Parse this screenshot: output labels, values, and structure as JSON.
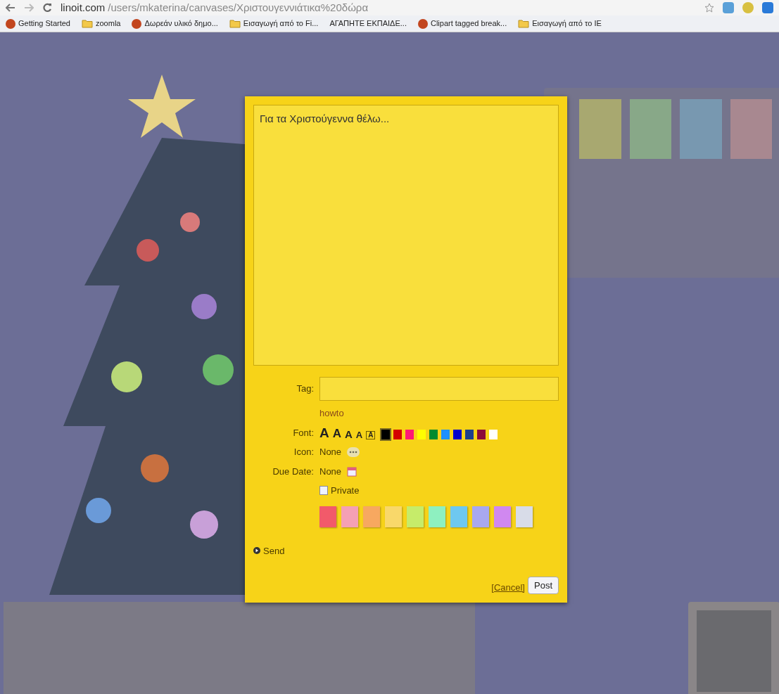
{
  "browser": {
    "url_host": "linoit.com",
    "url_path": "/users/mkaterina/canvases/Χριστουγεννιάτικα%20δώρα"
  },
  "bookmarks": [
    {
      "label": "Getting Started",
      "kind": "site"
    },
    {
      "label": "zoomla",
      "kind": "folder"
    },
    {
      "label": "Δωρεάν υλικό δημο...",
      "kind": "site"
    },
    {
      "label": "Εισαγωγή από το Fi...",
      "kind": "folder"
    },
    {
      "label": "ΑΓΑΠΗΤΕ ΕΚΠΑΙΔΕ...",
      "kind": "plain"
    },
    {
      "label": "Clipart tagged break...",
      "kind": "site"
    },
    {
      "label": "Εισαγωγή από το IE",
      "kind": "folder"
    }
  ],
  "note_dialog": {
    "text": "Για τα Χριστούγεννα θέλω...",
    "tag_label": "Tag:",
    "tag_hint": "howto",
    "font_label": "Font:",
    "font_sizes": [
      {
        "label": "A",
        "selected": false
      },
      {
        "label": "A",
        "selected": false
      },
      {
        "label": "A",
        "selected": false
      },
      {
        "label": "A",
        "selected": false
      },
      {
        "label": "A",
        "selected": true
      }
    ],
    "font_colors": [
      {
        "color": "#000000",
        "selected": true
      },
      {
        "color": "#d40000",
        "selected": false
      },
      {
        "color": "#ff1a75",
        "selected": false
      },
      {
        "color": "#ffff00",
        "selected": false
      },
      {
        "color": "#008a2e",
        "selected": false
      },
      {
        "color": "#1e90ff",
        "selected": false
      },
      {
        "color": "#0000cc",
        "selected": false
      },
      {
        "color": "#1c3f8c",
        "selected": false
      },
      {
        "color": "#8b0a3a",
        "selected": false
      },
      {
        "color": "#ffffff",
        "selected": false
      }
    ],
    "icon_label": "Icon:",
    "icon_value": "None",
    "due_label": "Due Date:",
    "due_value": "None",
    "private": {
      "label": "Private",
      "checked": false
    },
    "note_colors": [
      {
        "color": "#f25a6a",
        "selected": false
      },
      {
        "color": "#f5a0b4",
        "selected": false
      },
      {
        "color": "#f7a860",
        "selected": false
      },
      {
        "color": "#f9d86a",
        "selected": false
      },
      {
        "color": "#c6ec6a",
        "selected": false
      },
      {
        "color": "#8ef0c0",
        "selected": false
      },
      {
        "color": "#6ec8f0",
        "selected": false
      },
      {
        "color": "#a8a8f0",
        "selected": false
      },
      {
        "color": "#d088f0",
        "selected": false
      },
      {
        "color": "#d8dce8",
        "selected": false
      }
    ],
    "send": {
      "label": "Send",
      "expanded": false
    },
    "cancel": "[Cancel]",
    "post": "Post"
  }
}
